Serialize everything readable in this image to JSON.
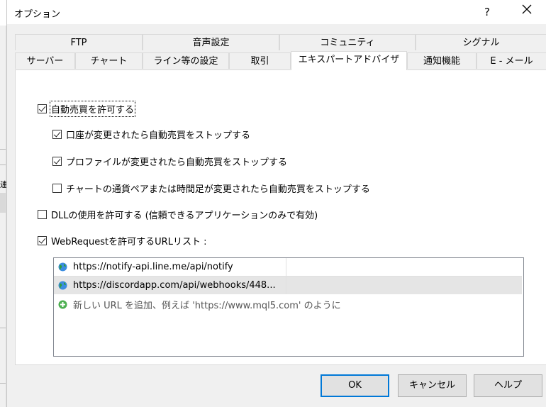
{
  "window": {
    "title": "オプション",
    "help_glyph": "?",
    "background_char": "連"
  },
  "tabs": {
    "row1": [
      "FTP",
      "音声設定",
      "コミュニティ",
      "シグナル"
    ],
    "row2": [
      "サーバー",
      "チャート",
      "ライン等の設定",
      "取引",
      "エキスパートアドバイザ",
      "通知機能",
      "E - メール"
    ],
    "active": "エキスパートアドバイザ"
  },
  "options": {
    "auto_trading": {
      "label": "自動売買を許可する",
      "checked": true
    },
    "stop_on_account_change": {
      "label": "口座が変更されたら自動売買をストップする",
      "checked": true
    },
    "stop_on_profile_change": {
      "label": "プロファイルが変更されたら自動売買をストップする",
      "checked": true
    },
    "stop_on_chart_change": {
      "label": "チャートの通貨ペアまたは時間足が変更されたら自動売買をストップする",
      "checked": false
    },
    "allow_dll": {
      "label": "DLLの使用を許可する (信頼できるアプリケーションのみで有効)",
      "checked": false
    },
    "allow_webrequest": {
      "label": "WebRequestを許可するURLリスト :",
      "checked": true
    }
  },
  "url_list": {
    "items": [
      "https://notify-api.line.me/api/notify",
      "https://discordapp.com/api/webhooks/448..."
    ],
    "add_hint": "新しい URL を追加、例えば 'https://www.mql5.com' のように"
  },
  "buttons": {
    "ok": "OK",
    "cancel": "キャンセル",
    "help": "ヘルプ"
  },
  "colors": {
    "accent": "#0078d7",
    "globe": "#2e7d32",
    "add": "#4caf50"
  }
}
